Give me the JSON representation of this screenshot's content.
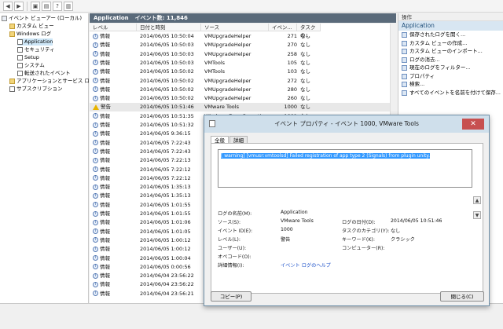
{
  "toolbar": {
    "icons": [
      "back-icon",
      "forward-icon",
      "folder-icon",
      "console-icon",
      "help-icon",
      "panel-icon"
    ]
  },
  "tree": {
    "items": [
      {
        "label": "イベント ビューアー (ローカル)",
        "depth": 0,
        "icon": "root"
      },
      {
        "label": "カスタム ビュー",
        "depth": 1,
        "icon": "folder"
      },
      {
        "label": "Windows ログ",
        "depth": 1,
        "icon": "folder"
      },
      {
        "label": "Application",
        "depth": 2,
        "icon": "log",
        "selected": true
      },
      {
        "label": "セキュリティ",
        "depth": 2,
        "icon": "log"
      },
      {
        "label": "Setup",
        "depth": 2,
        "icon": "log"
      },
      {
        "label": "システム",
        "depth": 2,
        "icon": "log"
      },
      {
        "label": "転送されたイベント",
        "depth": 2,
        "icon": "log"
      },
      {
        "label": "アプリケーションとサービス ログ",
        "depth": 1,
        "icon": "folder"
      },
      {
        "label": "サブスクリプション",
        "depth": 1,
        "icon": "log"
      }
    ]
  },
  "main": {
    "title": "Application",
    "count": "イベント数: 11,846"
  },
  "columns": [
    "レベル",
    "日付と時刻",
    "ソース",
    "イベン...",
    "タスクの..."
  ],
  "rows": [
    {
      "level": "情報",
      "date": "2014/06/05 10:50:04",
      "source": "VMUpgradeHelper",
      "id": "271",
      "task": "なし"
    },
    {
      "level": "情報",
      "date": "2014/06/05 10:50:03",
      "source": "VMUpgradeHelper",
      "id": "270",
      "task": "なし"
    },
    {
      "level": "情報",
      "date": "2014/06/05 10:50:03",
      "source": "VMUpgradeHelper",
      "id": "258",
      "task": "なし"
    },
    {
      "level": "情報",
      "date": "2014/06/05 10:50:03",
      "source": "VMTools",
      "id": "105",
      "task": "なし"
    },
    {
      "level": "情報",
      "date": "2014/06/05 10:50:02",
      "source": "VMTools",
      "id": "103",
      "task": "なし"
    },
    {
      "level": "情報",
      "date": "2014/06/05 10:50:02",
      "source": "VMUpgradeHelper",
      "id": "272",
      "task": "なし"
    },
    {
      "level": "情報",
      "date": "2014/06/05 10:50:02",
      "source": "VMUpgradeHelper",
      "id": "280",
      "task": "なし"
    },
    {
      "level": "情報",
      "date": "2014/06/05 10:50:02",
      "source": "VMUpgradeHelper",
      "id": "260",
      "task": "なし"
    },
    {
      "level": "警告",
      "date": "2014/06/05 10:51:46",
      "source": "VMware Tools",
      "id": "1000",
      "task": "なし",
      "warn": true,
      "selected": true
    },
    {
      "level": "情報",
      "date": "2014/06/05 10:51:35",
      "source": "Windows Error Reporting",
      "id": "1001",
      "task": "なし"
    },
    {
      "level": "情報",
      "date": "2014/06/05 10:51:32",
      "source": "",
      "id": "",
      "task": ""
    },
    {
      "level": "情報",
      "date": "2014/06/05 9:36:15",
      "source": "",
      "id": "",
      "task": ""
    },
    {
      "level": "情報",
      "date": "2014/06/05 7:22:43",
      "source": "",
      "id": "",
      "task": ""
    },
    {
      "level": "情報",
      "date": "2014/06/05 7:22:43",
      "source": "",
      "id": "",
      "task": ""
    },
    {
      "level": "情報",
      "date": "2014/06/05 7:22:13",
      "source": "",
      "id": "",
      "task": ""
    },
    {
      "level": "情報",
      "date": "2014/06/05 7:22:12",
      "source": "",
      "id": "",
      "task": ""
    },
    {
      "level": "情報",
      "date": "2014/06/05 7:22:12",
      "source": "",
      "id": "",
      "task": ""
    },
    {
      "level": "情報",
      "date": "2014/06/05 1:35:13",
      "source": "",
      "id": "",
      "task": ""
    },
    {
      "level": "情報",
      "date": "2014/06/05 1:35:13",
      "source": "",
      "id": "",
      "task": ""
    },
    {
      "level": "情報",
      "date": "2014/06/05 1:01:55",
      "source": "",
      "id": "",
      "task": ""
    },
    {
      "level": "情報",
      "date": "2014/06/05 1:01:55",
      "source": "",
      "id": "",
      "task": ""
    },
    {
      "level": "情報",
      "date": "2014/06/05 1:01:06",
      "source": "",
      "id": "",
      "task": ""
    },
    {
      "level": "情報",
      "date": "2014/06/05 1:01:05",
      "source": "",
      "id": "",
      "task": ""
    },
    {
      "level": "情報",
      "date": "2014/06/05 1:00:12",
      "source": "",
      "id": "",
      "task": ""
    },
    {
      "level": "情報",
      "date": "2014/06/05 1:00:12",
      "source": "",
      "id": "",
      "task": ""
    },
    {
      "level": "情報",
      "date": "2014/06/05 1:00:04",
      "source": "",
      "id": "",
      "task": ""
    },
    {
      "level": "情報",
      "date": "2014/06/05 0:00:56",
      "source": "",
      "id": "",
      "task": ""
    },
    {
      "level": "情報",
      "date": "2014/06/04 23:56:22",
      "source": "",
      "id": "",
      "task": ""
    },
    {
      "level": "情報",
      "date": "2014/06/04 23:56:22",
      "source": "",
      "id": "",
      "task": ""
    },
    {
      "level": "情報",
      "date": "2014/06/04 23:56:21",
      "source": "",
      "id": "",
      "task": ""
    }
  ],
  "actions": {
    "header": "操作",
    "section": "Application",
    "items": [
      "保存されたログを開く...",
      "カスタム ビューの作成...",
      "カスタム ビューのインポート...",
      "ログの消去...",
      "現在のログをフィルター...",
      "プロパティ",
      "検索...",
      "すべてのイベントを名前を付けて保存..."
    ],
    "partial_label": "ls"
  },
  "dialog": {
    "title": "イベント プロパティ - イベント 1000, VMware Tools",
    "close": "✕",
    "tabs": [
      "全般",
      "詳細"
    ],
    "message": "[ warning] [vmusr:vmtoolsd] Failed registration of app type 2 (Signals) from plugin unity.",
    "fields": {
      "log_name_label": "ログの名前(M):",
      "log_name": "Application",
      "source_label": "ソース(S):",
      "source": "VMware Tools",
      "logged_label": "ログの日付(D):",
      "logged": "2014/06/05 10:51:46",
      "event_id_label": "イベント ID(E):",
      "event_id": "1000",
      "task_label": "タスクのカテゴリ(Y):",
      "task": "なし",
      "level_label": "レベル(L):",
      "level": "警告",
      "keywords_label": "キーワード(K):",
      "keywords": "クラシック",
      "user_label": "ユーザー(U):",
      "computer_label": "コンピューター(R):",
      "opcode_label": "オペコード(O):",
      "more_label": "詳細情報(I):",
      "more_link": "イベント ログのヘルプ"
    },
    "copy_button": "コピー(P)",
    "close_button": "閉じる(C)"
  }
}
